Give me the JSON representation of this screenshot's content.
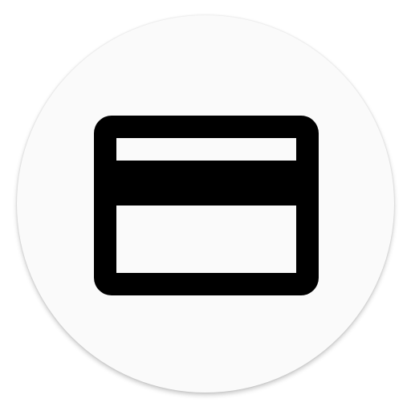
{
  "app_icon": {
    "icon": "credit-card-icon",
    "background_color": "#fafafa",
    "glyph_color": "#000000"
  }
}
